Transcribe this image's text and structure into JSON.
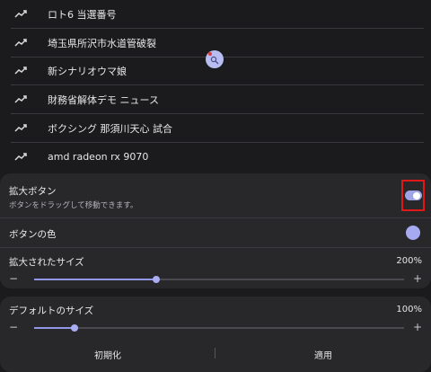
{
  "trending": {
    "items": [
      {
        "label": "ロト6 当選番号",
        "icon": "trending-up-icon"
      },
      {
        "label": "埼玉県所沢市水道管破裂",
        "icon": "trending-up-icon"
      },
      {
        "label": "新シナリオウマ娘",
        "icon": "trending-up-icon"
      },
      {
        "label": "財務省解体デモ ニュース",
        "icon": "trending-up-icon"
      },
      {
        "label": "ボクシング 那須川天心 試合",
        "icon": "trending-up-icon"
      },
      {
        "label": "amd radeon rx 9070",
        "icon": "trending-up-icon"
      }
    ]
  },
  "magnifier_button": {
    "icon": "magnifier-icon",
    "color": "#b8bdf2"
  },
  "settings": {
    "magnify_button": {
      "title": "拡大ボタン",
      "subtitle": "ボタンをドラッグして移動できます。",
      "enabled": true
    },
    "button_color": {
      "title": "ボタンの色",
      "color": "#a6aaf0"
    },
    "magnified_size": {
      "title": "拡大されたサイズ",
      "value_text": "200%",
      "minus": "−",
      "plus": "+",
      "level": 0.33
    },
    "default_size": {
      "title": "デフォルトのサイズ",
      "value_text": "100%",
      "minus": "−",
      "plus": "+",
      "level": 0.11
    },
    "actions": {
      "reset": "初期化",
      "apply": "適用"
    }
  },
  "colors": {
    "accent": "#9ea4e6",
    "highlight": "#e01818",
    "background": "#1b1b1d",
    "panel": "#28282b"
  }
}
